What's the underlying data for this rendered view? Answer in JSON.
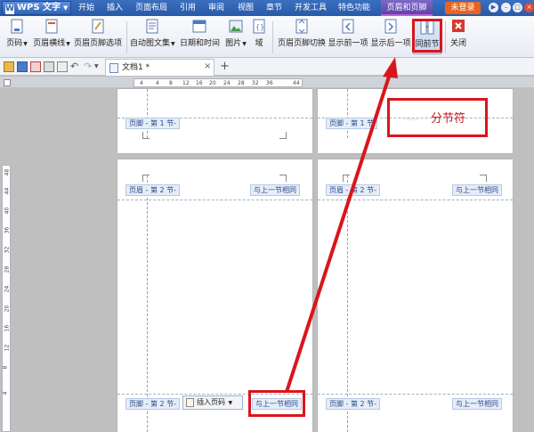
{
  "app": {
    "name": "WPS 文字"
  },
  "menu": {
    "tabs": [
      "开始",
      "插入",
      "页面布局",
      "引用",
      "审阅",
      "视图",
      "章节",
      "开发工具",
      "特色功能",
      "页眉和页脚"
    ],
    "login": "未登录"
  },
  "ribbon": {
    "page_number": "页码",
    "header_line": "页眉横线",
    "header_options": "页眉页脚选项",
    "auto_text": "自动图文集",
    "date_time": "日期和时间",
    "picture": "图片",
    "field": "域",
    "switch_hf": "页眉页脚切换",
    "show_prev": "显示前一项",
    "show_next": "显示后一项",
    "same_as_prev": "同前节",
    "close": "关闭"
  },
  "document": {
    "tab_name": "文档1 *"
  },
  "ruler": {
    "ticks": [
      "4",
      "4",
      "8",
      "12",
      "16",
      "20",
      "24",
      "28",
      "32",
      "36",
      "44"
    ]
  },
  "vruler": {
    "ticks": [
      "48",
      "44",
      "40",
      "36",
      "32",
      "28",
      "24",
      "20",
      "16",
      "12",
      "8",
      "4"
    ]
  },
  "pages": {
    "footer_s1": "页脚 - 第 1 节-",
    "footer_s1_b": "页脚 - 第 1 节",
    "header_s2": "页眉 - 第 2 节-",
    "footer_s2": "页脚 - 第 2 节-",
    "same_prev": "与上一节相同",
    "insert_page_number": "插入页码",
    "section_break": "分节符"
  },
  "colors": {
    "accent": "#2a5aa8",
    "annotation": "#d9161c"
  }
}
